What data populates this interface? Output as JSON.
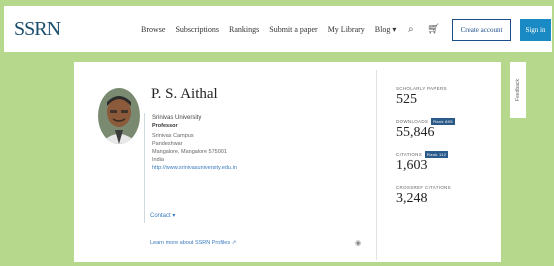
{
  "header": {
    "logo": "SSRN",
    "nav": [
      "Browse",
      "Subscriptions",
      "Rankings",
      "Submit a paper",
      "My Library",
      "Blog ▾"
    ],
    "search_icon": "search-icon",
    "cart_icon": "cart-icon",
    "create_account": "Create account",
    "sign_in": "Sign in"
  },
  "profile": {
    "name": "P. S. Aithal",
    "institution": "Srinivas University",
    "role": "Professor",
    "address": [
      "Srinivas Campus",
      "Pandeshwar",
      "Mangalore, Mangalore 575001",
      "India"
    ],
    "url": "http://www.srinivasuniversity.edu.in",
    "contact": "Contact ▾",
    "learn_more": "Learn more about SSRN Profiles ↗"
  },
  "stats": [
    {
      "label": "SCHOLARLY PAPERS",
      "value": "525",
      "badge": ""
    },
    {
      "label": "DOWNLOADS",
      "value": "55,846",
      "badge": "Rank 895"
    },
    {
      "label": "CITATIONS",
      "value": "1,603",
      "badge": "Rank 112"
    },
    {
      "label": "CROSSREF CITATIONS",
      "value": "3,248",
      "badge": ""
    }
  ],
  "feedback": "Feedback"
}
